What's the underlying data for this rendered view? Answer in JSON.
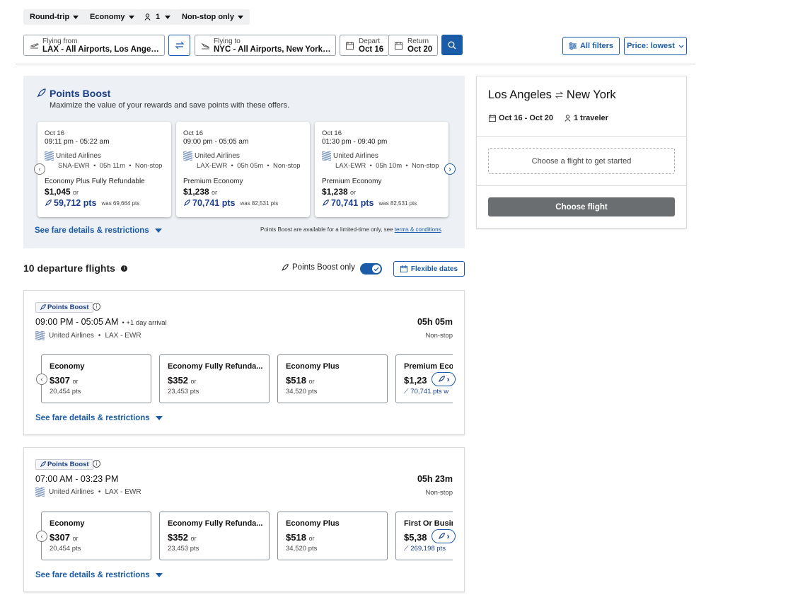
{
  "toolbar": {
    "trip_type": "Round-trip",
    "cabin": "Economy",
    "travelers": "1",
    "stops": "Non-stop only"
  },
  "search": {
    "from_label": "Flying from",
    "from_value": "LAX - All Airports, Los Angeles...",
    "to_label": "Flying to",
    "to_value": "NYC - All Airports, New York, ...",
    "depart_label": "Depart",
    "depart_value": "Oct 16",
    "return_label": "Return",
    "return_value": "Oct 20",
    "all_filters": "All filters",
    "sort": "Price: lowest"
  },
  "points_boost": {
    "title": "Points Boost",
    "subtitle": "Maximize the value of your rewards and save points with these offers.",
    "cards": [
      {
        "date": "Oct 16",
        "time": "09:11 pm - 05:22 am",
        "airline": "United Airlines",
        "route": "SNA-EWR  •  05h 11m  •  Non-stop",
        "cabin": "Economy Plus Fully Refundable",
        "price": "$1,045",
        "or": "or",
        "points": "59,712 pts",
        "was": "was 69,664 pts"
      },
      {
        "date": "Oct 16",
        "time": "09:00 pm - 05:05 am",
        "airline": "United Airlines",
        "route": "LAX-EWR  •  05h 05m  •  Non-stop",
        "cabin": "Premium Economy",
        "price": "$1,238",
        "or": "or",
        "points": "70,741 pts",
        "was": "was 82,531 pts"
      },
      {
        "date": "Oct 16",
        "time": "01:30 pm - 09:40 pm",
        "airline": "United Airlines",
        "route": "LAX-EWR  •  05h 10m  •  Non-stop",
        "cabin": "Premium Economy",
        "price": "$1,238",
        "or": "or",
        "points": "70,741 pts",
        "was": "was 82,531 pts"
      }
    ],
    "see_details": "See fare details & restrictions",
    "disclaimer": "Points Boost are available for a limited-time only, see",
    "terms_link": "terms & conditions",
    "period": "."
  },
  "results": {
    "count_label": "10 departure flights",
    "boost_only_label": "Points Boost only",
    "flexible_dates": "Flexible dates"
  },
  "flights": [
    {
      "badge": "Points Boost",
      "times": "09:00 PM - 05:05 AM",
      "arrival_note": "+1 day arrival",
      "airline": "United Airlines",
      "route": "LAX - EWR",
      "duration": "05h 05m",
      "stops": "Non-stop",
      "fares": [
        {
          "name": "Economy",
          "price": "$307",
          "or": "or",
          "points": "20,454 pts"
        },
        {
          "name": "Economy Fully Refunda...",
          "price": "$352",
          "or": "or",
          "points": "23,453 pts"
        },
        {
          "name": "Economy Plus",
          "price": "$518",
          "or": "or",
          "points": "34,520 pts"
        },
        {
          "name": "Premium Eco",
          "price": "$1,23",
          "points": "70,741 pts w"
        }
      ],
      "see_details": "See fare details & restrictions"
    },
    {
      "badge": "Points Boost",
      "times": "07:00 AM - 03:23 PM",
      "arrival_note": "",
      "airline": "United Airlines",
      "route": "LAX - EWR",
      "duration": "05h 23m",
      "stops": "Non-stop",
      "fares": [
        {
          "name": "Economy",
          "price": "$307",
          "or": "or",
          "points": "20,454 pts"
        },
        {
          "name": "Economy Fully Refunda...",
          "price": "$352",
          "or": "or",
          "points": "23,453 pts"
        },
        {
          "name": "Economy Plus",
          "price": "$518",
          "or": "or",
          "points": "34,520 pts"
        },
        {
          "name": "First Or Busin",
          "price": "$5,38",
          "points": "269,198 pts"
        }
      ],
      "see_details": "See fare details & restrictions"
    }
  ],
  "summary": {
    "from_city": "Los Angeles",
    "to_city": "New York",
    "dates": "Oct 16 - Oct 20",
    "travelers": "1 traveler",
    "prompt": "Choose a flight to get started",
    "button": "Choose flight"
  },
  "colors": {
    "accent": "#1a5ca8",
    "points": "#1a3e8c",
    "button_disabled": "#6b6e70"
  }
}
